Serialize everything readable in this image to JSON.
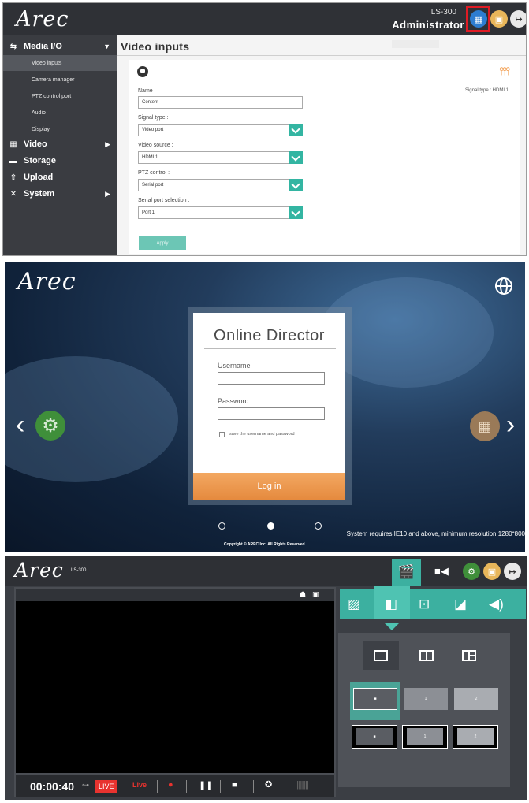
{
  "panel1": {
    "logo": "Arec",
    "model": "LS-300",
    "user": "Administrator",
    "page_title": "Video inputs",
    "sidebar": {
      "media_io": "Media I/O",
      "sub_items": [
        "Video inputs",
        "Camera manager",
        "PTZ control port",
        "Audio",
        "Display"
      ],
      "video": "Video",
      "storage": "Storage",
      "upload": "Upload",
      "system": "System"
    },
    "form": {
      "signal_info": "Signal type :  HDMI 1",
      "name_label": "Name :",
      "name_value": "Content",
      "signal_label": "Signal type :",
      "signal_value": "Video port",
      "source_label": "Video source :",
      "source_value": "HDMI 1",
      "ptz_label": "PTZ control :",
      "ptz_value": "Serial port",
      "serial_label": "Serial port selection :",
      "serial_value": "Port 1",
      "apply": "Apply"
    }
  },
  "panel2": {
    "logo": "Arec",
    "card_title": "Online Director",
    "username_label": "Username",
    "password_label": "Password",
    "save_label": "save the username and password",
    "login_button": "Log in",
    "requirement": "System requires IE10 and above, minimum resolution 1280*800",
    "copyright": "Copyright © AREC Inc. All Rights Reserved."
  },
  "panel3": {
    "logo": "Arec",
    "model": "LS-300",
    "timecode": "00:00:40",
    "live_badge": "LIVE",
    "live_text": "Live",
    "sources_row1": [
      "■",
      "1",
      "2"
    ],
    "sources_row2": [
      "■",
      "1",
      "2"
    ]
  },
  "colors": {
    "accent": "#3cb0a0",
    "orange": "#e58a3e",
    "dark": "#2f3136",
    "live_red": "#e8332f"
  }
}
